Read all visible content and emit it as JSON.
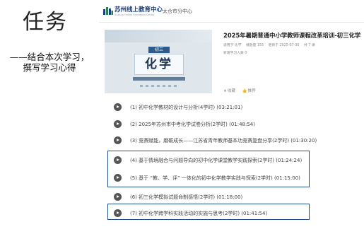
{
  "slide": {
    "title": "任务",
    "desc_line1": "——结合本次学习，",
    "desc_line2": "撰写学习心得"
  },
  "site": {
    "name": "苏州线上教育中心",
    "name_en": "Suzhou Online Education Center",
    "region": "太仓市分中心",
    "logo_color": "#1a3f7a"
  },
  "course": {
    "cover_tag": "初三",
    "cover_subject": "化学",
    "title": "2025年暑期普通中小学教师课程改革培训-初三化学",
    "meta": {
      "subject": "适用于 化学",
      "plays": "播放量 155",
      "updated": "更新于 2025-07-30",
      "count": "共 7 课"
    },
    "learners": "新增学习人数 0",
    "actions": {
      "favorite": "收藏",
      "recommend": "推荐"
    }
  },
  "episodes": [
    {
      "text": "(1) 初中化学教材的设计与分析(4学时)  (03:21:01)",
      "highlighted": false
    },
    {
      "text": "(2) 2025年苏州市中考化学试卷分析(2学时)  (01:48:54)",
      "highlighted": false
    },
    {
      "text": "(3) 竞赛赋能，磨砺成长——江苏省青年教师基本功竞赛复盘分享(2学时)  (01:30:20)",
      "highlighted": false
    },
    {
      "text": "(4) 基于情境融合与问题导向的初中化学课堂教学实践探索(2学时)  (01:24:24)",
      "highlighted": true
    },
    {
      "text": "(5) 基于 “教、学、评” 一体化的初中化学教学实践与探索(2学时)  (01:15:00)",
      "highlighted": true
    },
    {
      "text": "(6) 初三化学模拟试题命制感悟(2学时)  (01:18:00)",
      "highlighted": false
    },
    {
      "text": "(7) 初中化学跨学科实践活动的实施与思考(2学时)  (01:41:54)",
      "highlighted": true
    }
  ],
  "colors": {
    "highlight_border": "#1f4e8c",
    "play_icon": "#555555"
  }
}
